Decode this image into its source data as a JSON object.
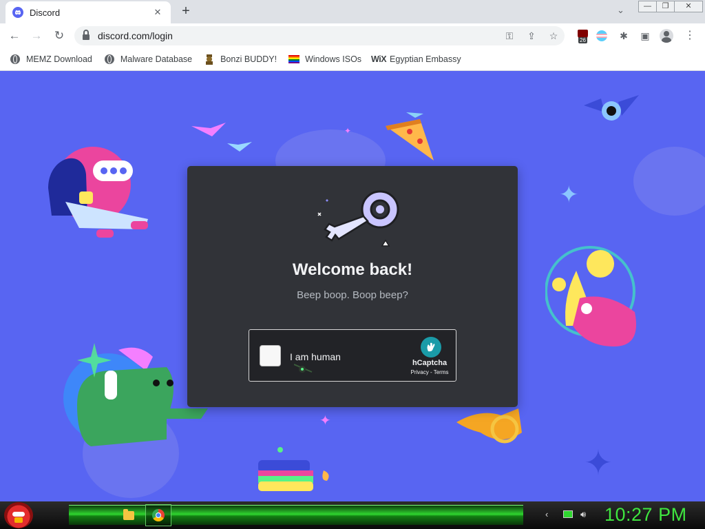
{
  "tab": {
    "title": "Discord",
    "close": "✕",
    "new_tab": "+",
    "menu": "⌄"
  },
  "window_controls": {
    "minimize": "—",
    "restore": "❐",
    "close": "✕"
  },
  "nav": {
    "back": "←",
    "forward": "→",
    "reload": "↻"
  },
  "omnibox": {
    "url": "discord.com/login",
    "key_icon": "⚿",
    "share_icon": "⇪",
    "star_icon": "☆"
  },
  "extensions": {
    "ublock_badge": "26",
    "puzzle": "✱",
    "sidepanel": "▣",
    "menu": "⋮"
  },
  "bookmarks": [
    {
      "label": "MEMZ Download",
      "icon": "globe-icon"
    },
    {
      "label": "Malware Database",
      "icon": "globe-icon"
    },
    {
      "label": "Bonzi BUDDY!",
      "icon": "bonzi-icon"
    },
    {
      "label": "Windows ISOs",
      "icon": "rainbow-flag-icon"
    },
    {
      "label": "Egyptian Embassy",
      "icon": "wix-icon",
      "icon_text": "WiX"
    }
  ],
  "login": {
    "heading": "Welcome back!",
    "subtitle": "Beep boop. Boop beep?",
    "captcha": {
      "label": "I am human",
      "brand": "hCaptcha",
      "links": "Privacy - Terms"
    }
  },
  "taskbar": {
    "clock": "10:27 PM",
    "apps": [
      "file-explorer",
      "chrome"
    ]
  },
  "colors": {
    "discord_blurple": "#5865f2",
    "card": "#313338",
    "clock_green": "#3fe63f"
  }
}
